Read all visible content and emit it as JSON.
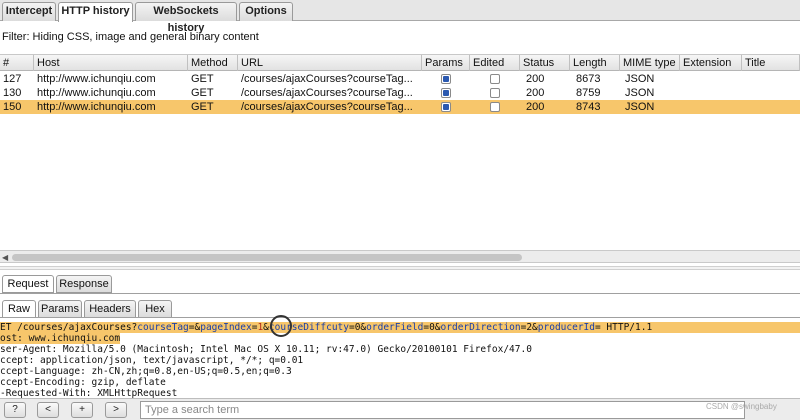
{
  "top_tabs": [
    "Intercept",
    "HTTP history",
    "WebSockets history",
    "Options"
  ],
  "filter_text": "Filter: Hiding CSS, image and general binary content",
  "columns": [
    "#",
    "Host",
    "Method",
    "URL",
    "Params",
    "Edited",
    "Status",
    "Length",
    "MIME type",
    "Extension",
    "Title"
  ],
  "rows": [
    {
      "num": "127",
      "host": "http://www.ichunqiu.com",
      "method": "GET",
      "url": "/courses/ajaxCourses?courseTag...",
      "params": true,
      "edited": false,
      "status": "200",
      "length": "8673",
      "mime": "JSON",
      "selected": false
    },
    {
      "num": "130",
      "host": "http://www.ichunqiu.com",
      "method": "GET",
      "url": "/courses/ajaxCourses?courseTag...",
      "params": true,
      "edited": false,
      "status": "200",
      "length": "8759",
      "mime": "JSON",
      "selected": false
    },
    {
      "num": "150",
      "host": "http://www.ichunqiu.com",
      "method": "GET",
      "url": "/courses/ajaxCourses?courseTag...",
      "params": true,
      "edited": false,
      "status": "200",
      "length": "8743",
      "mime": "JSON",
      "selected": true
    }
  ],
  "req_tabs": [
    "Request",
    "Response"
  ],
  "view_tabs": [
    "Raw",
    "Params",
    "Headers",
    "Hex"
  ],
  "raw": {
    "l0_a": "ET /courses/ajaxCourses?",
    "l0_b": "courseTag",
    "l0_c": "=&",
    "l0_d": "pageIndex",
    "l0_e": "=",
    "l0_f": "1",
    "l0_g": "&",
    "l0_h": "courseDiffcuty",
    "l0_i": "=0&",
    "l0_j": "orderField",
    "l0_k": "=0&",
    "l0_l": "orderDirection",
    "l0_m": "=2&",
    "l0_n": "producerId",
    "l0_o": "= HTTP/1.1",
    "l1": "ost: www.ichunqiu.com",
    "l2": "ser-Agent: Mozilla/5.0 (Macintosh; Intel Mac OS X 10.11; rv:47.0) Gecko/20100101 Firefox/47.0",
    "l3": "ccept: application/json, text/javascript, */*; q=0.01",
    "l4": "ccept-Language: zh-CN,zh;q=0.8,en-US;q=0.5,en;q=0.3",
    "l5": "ccept-Encoding: gzip, deflate",
    "l6": "-Requested-With: XMLHttpRequest"
  },
  "bottom_buttons": [
    "?",
    "<",
    "+",
    ">"
  ],
  "search_placeholder": "Type a search term",
  "watermark": "CSDN @swingbaby"
}
